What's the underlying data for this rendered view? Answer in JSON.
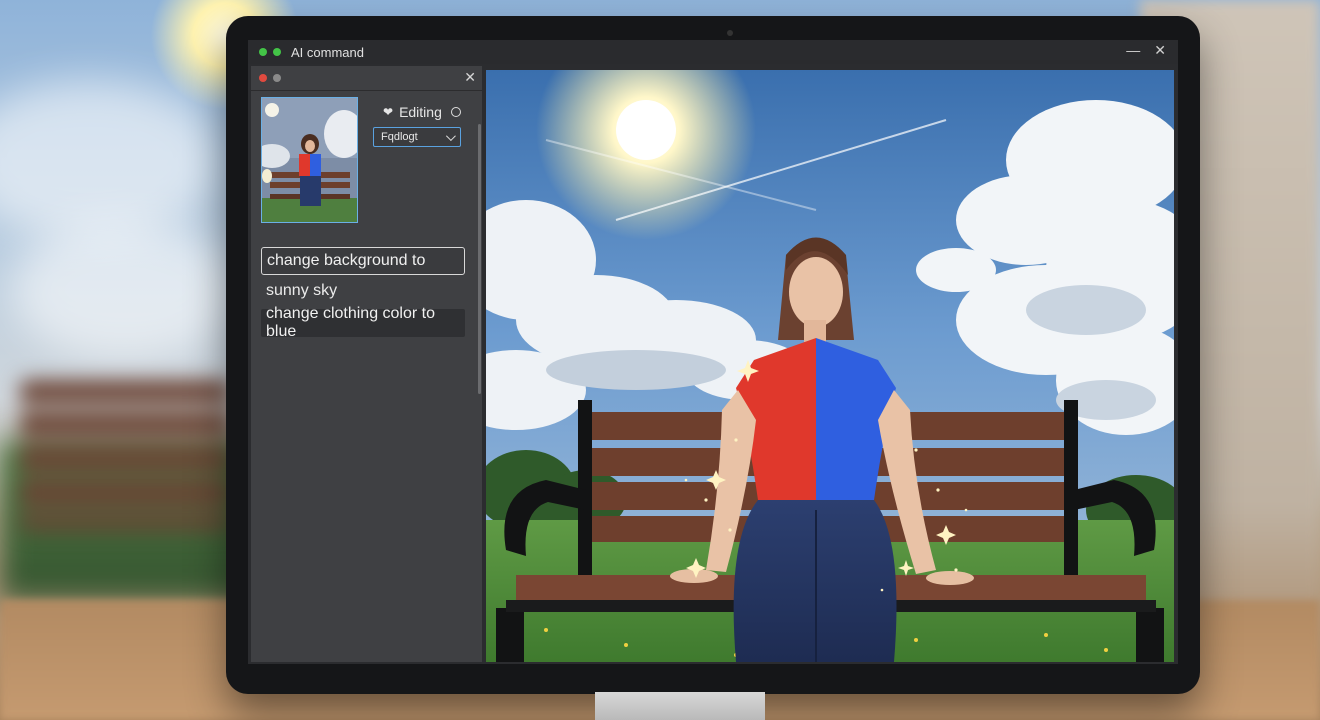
{
  "window": {
    "title": "AI command",
    "minimize_glyph": "—",
    "close_glyph": "✕"
  },
  "panel": {
    "close_glyph": "✕",
    "mode_label": "Editing",
    "mode_icon": "heart-icon",
    "dropdown_value": "Fqdlogt",
    "commands": {
      "input_value": "change background to",
      "continuation": "sunny sky",
      "history_item": "change clothing color to blue"
    }
  },
  "colors": {
    "accent": "#5aa2e0",
    "shirt_red": "#e0382c",
    "shirt_blue": "#2f5fe0",
    "window_dot_green": "#43c447",
    "panel_dot_red": "#e04a3f"
  }
}
